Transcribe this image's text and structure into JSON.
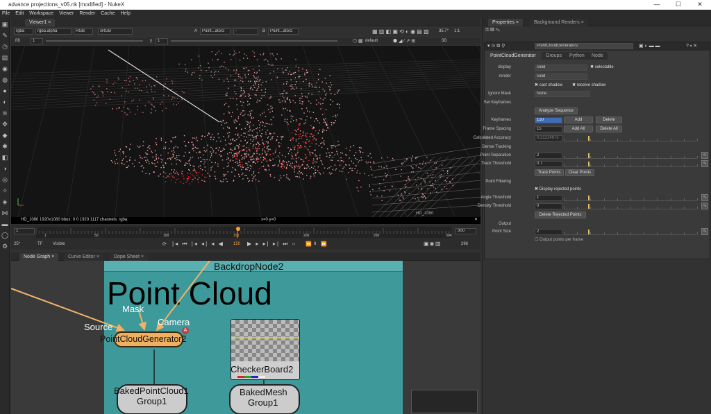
{
  "window": {
    "title": "advance projections_v05.nk [modified] - NukeX",
    "controls": [
      "—",
      "☐",
      "✕"
    ]
  },
  "menu": [
    "File",
    "Edit",
    "Workspace",
    "Viewer",
    "Render",
    "Cache",
    "Help"
  ],
  "viewer": {
    "tab": "Viewer1",
    "toolbar1": {
      "channel": "rgba",
      "alpha": "rgba.alpha",
      "rgb": "RGB",
      "colorspace": "sRGB",
      "a_label": "A",
      "a_input": "Point...ator2",
      "dash": "-",
      "b_label": "B",
      "b_input": "Point...ator2",
      "zoom": "35.7°",
      "ratio": "1:1"
    },
    "toolbar2": {
      "fstop": "f/8",
      "frame": "1",
      "y_label": "y",
      "y_value": "1",
      "view_default": "default",
      "view_mode": "3D"
    },
    "status": "HD_1080 1920x1080  bbox: 0 0 1920 1117 channels: rgba",
    "coords": "x=0 y=0",
    "format_overlay": "HD_1080"
  },
  "timeline": {
    "start": "1",
    "end": "300",
    "ticks": [
      "1",
      "50",
      "100",
      "150",
      "200",
      "250",
      "304"
    ],
    "current_frame": "150",
    "fps": "25*",
    "tf": "TF",
    "visible": "Visible",
    "step": "8",
    "end_frame_box": "296"
  },
  "nodegraph": {
    "tabs": [
      "Node Graph",
      "Curve Editor",
      "Dope Sheet"
    ],
    "backdrop_label": "BackdropNode2",
    "backdrop_title": "Point Cloud",
    "labels": {
      "mask": "Mask",
      "source": "Source",
      "camera": "Camera"
    },
    "nodes": {
      "pcg": "PointCloudGenerator2",
      "checker": "CheckerBoard2",
      "baked_pc_1": "BakedPointCloud1",
      "baked_pc_2": "Group1",
      "baked_mesh_1": "BakedMesh",
      "baked_mesh_2": "Group1"
    },
    "colors": {
      "backdrop": "#3e9a9a",
      "pcg_node": "#f0b060",
      "group_node": "#cccccc",
      "arrow": "#f2b26a"
    }
  },
  "properties": {
    "tabs": [
      "Properties",
      "Background Renders"
    ],
    "node_name": "PointCloudGenerator2",
    "subtabs": [
      "PointCloudGenerator",
      "Groups",
      "Python",
      "Node"
    ],
    "display_label": "display",
    "display_value": "solid",
    "selectable": "selectable",
    "render_label": "render",
    "render_value": "solid",
    "cast_shadow": "cast shadow",
    "receive_shadow": "receive shadow",
    "ignore_mask_label": "Ignore Mask",
    "ignore_mask_value": "None",
    "set_keyframes": "Set Keyframes",
    "analyze_sequence": "Analyze Sequence",
    "keyframes_label": "Keyframes",
    "keyframes_value": "150",
    "add": "Add",
    "delete": "Delete",
    "frame_spacing_label": "Frame Spacing",
    "frame_spacing_value": "15",
    "add_all": "Add All",
    "delete_all": "Delete All",
    "calc_accuracy_label": "Calculated Accuracy",
    "calc_accuracy_value": "0.21214675",
    "dense_tracking": "Dense Tracking",
    "point_sep_label": "Point Separation",
    "point_sep_value": "2",
    "track_thresh_label": "Track Threshold",
    "track_thresh_value": "0.7",
    "track_points": "Track Points",
    "clear_points": "Clear Points",
    "point_filtering": "Point Filtering",
    "display_rejected": "Display rejected points",
    "angle_thresh_label": "Angle Threshold",
    "angle_thresh_value": "1",
    "density_thresh_label": "Density Threshold",
    "density_thresh_value": "0",
    "delete_rejected": "Delete Rejected Points",
    "output": "Output",
    "point_size_label": "Point Size",
    "point_size_value": "2",
    "output_per_frame": "Output points per frame",
    "slider_ticks_a": [
      "0",
      "1",
      "2",
      "3",
      "4",
      "5",
      "6",
      "7",
      "8",
      "9",
      "10"
    ],
    "slider_ticks_b": [
      "0",
      "0.1",
      "0.2",
      "0.3",
      "0.4",
      "0.5",
      "0.6",
      "0.7",
      "0.8",
      "0.9",
      "1"
    ],
    "slider_ticks_c": [
      "0",
      "2",
      "4",
      "6",
      "8",
      "10",
      "12",
      "14",
      "16",
      "18",
      "20"
    ]
  }
}
